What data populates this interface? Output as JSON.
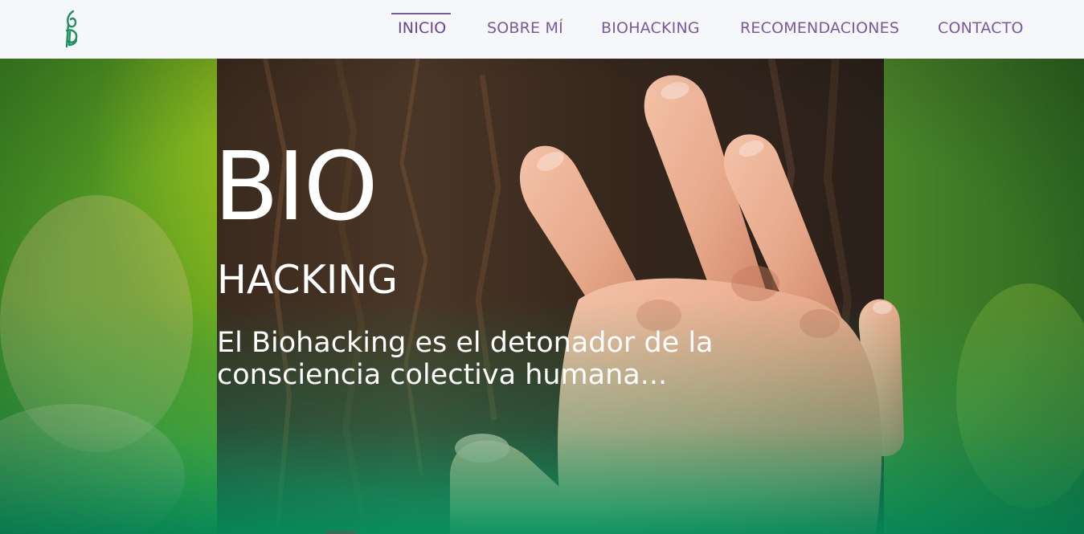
{
  "brand": {
    "logo_icon": "leaf-b-monogram-icon",
    "logo_color": "#1f8f5f"
  },
  "nav": {
    "items": [
      {
        "label": "INICIO",
        "active": true
      },
      {
        "label": "SOBRE MÍ",
        "active": false
      },
      {
        "label": "BIOHACKING",
        "active": false
      },
      {
        "label": "RECOMENDACIONES",
        "active": false
      },
      {
        "label": "CONTACTO",
        "active": false
      }
    ],
    "color": "#7b5a9c"
  },
  "hero": {
    "title": "BIO",
    "subtitle": "HACKING",
    "tagline": "El Biohacking es el detonador de la consciencia colectiva humana...",
    "background": "hand-on-tree-bark-photo",
    "accent_gradient": "#0a9a66"
  }
}
